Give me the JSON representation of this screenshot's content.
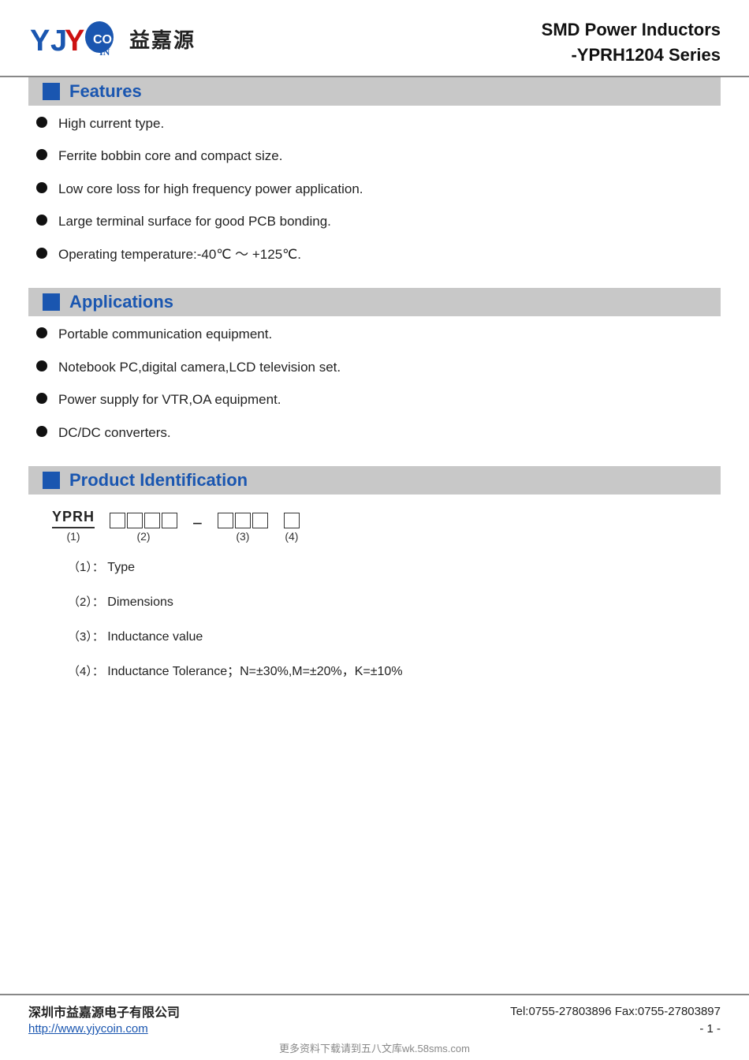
{
  "header": {
    "title_line1": "SMD Power Inductors",
    "title_line2": "-YPRH1204 Series",
    "logo_cn": "益嘉源"
  },
  "features": {
    "section_title": "Features",
    "items": [
      "High current type.",
      "Ferrite bobbin core and compact size.",
      "Low core loss for high frequency power application.",
      "Large terminal surface for good PCB bonding.",
      "Operating temperature:-40℃ ～ +125℃."
    ]
  },
  "applications": {
    "section_title": "Applications",
    "items": [
      "Portable communication equipment.",
      "Notebook PC,digital camera,LCD television set.",
      "Power supply for VTR,OA equipment.",
      "DC/DC converters."
    ]
  },
  "product_identification": {
    "section_title": "Product Identification",
    "code_prefix": "YPRH",
    "label1": "(1)",
    "label2": "(2)",
    "label3": "(3)",
    "label4": "(4)",
    "def1_num": "（1）：",
    "def1_text": "Type",
    "def2_num": "（2）：",
    "def2_text": "Dimensions",
    "def3_num": "（3）：",
    "def3_text": "Inductance value",
    "def4_num": "（4）：",
    "def4_text": "Inductance Tolerance；N=±30%,M=±20%，K=±10%"
  },
  "footer": {
    "company": "深圳市益嘉源电子有限公司",
    "contact": "Tel:0755-27803896   Fax:0755-27803897",
    "url": "http://www.yjycoin.com",
    "page": "- 1 -",
    "bottom_text": "更多资料下载请到五八文库wk.58sms.com"
  }
}
